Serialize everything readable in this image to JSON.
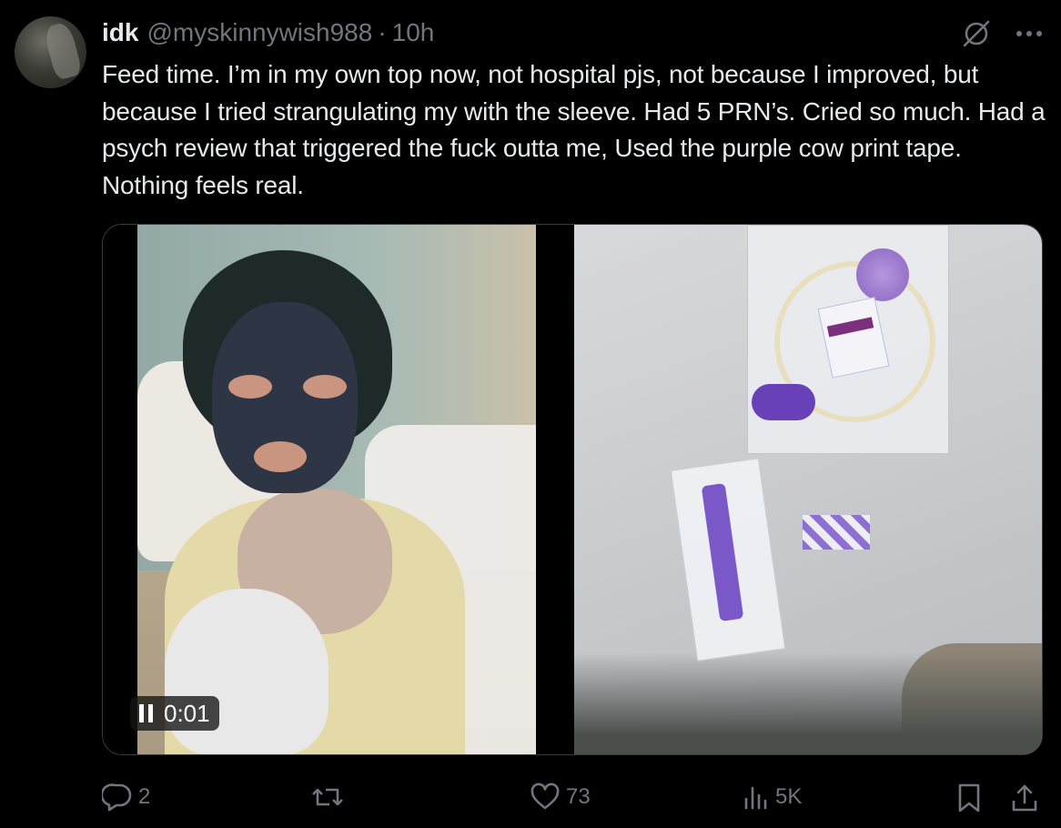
{
  "author": {
    "display_name": "idk",
    "handle": "@myskinnywish988",
    "separator": "·",
    "time": "10h"
  },
  "tweet": {
    "text": "Feed time. I’m in my own top now, not hospital pjs, not because I improved, but because I tried strangulating my with the sleeve. Had 5 PRN’s. Cried so much. Had a psych review that triggered the fuck outta me, Used the purple cow print tape. Nothing feels real."
  },
  "media": {
    "video": {
      "time_label": "0:01",
      "state": "playing"
    },
    "photo": {}
  },
  "actions": {
    "replies": "2",
    "reposts": "",
    "likes": "73",
    "views": "5K"
  },
  "icons": {
    "top": [
      "grok-icon",
      "more-icon"
    ],
    "actions": [
      "reply-icon",
      "repost-icon",
      "like-icon",
      "views-icon",
      "bookmark-icon",
      "share-icon"
    ]
  },
  "colors": {
    "background": "#000000",
    "text_primary": "#e7e9ea",
    "text_secondary": "#71767b",
    "media_border": "#3a3d40"
  }
}
